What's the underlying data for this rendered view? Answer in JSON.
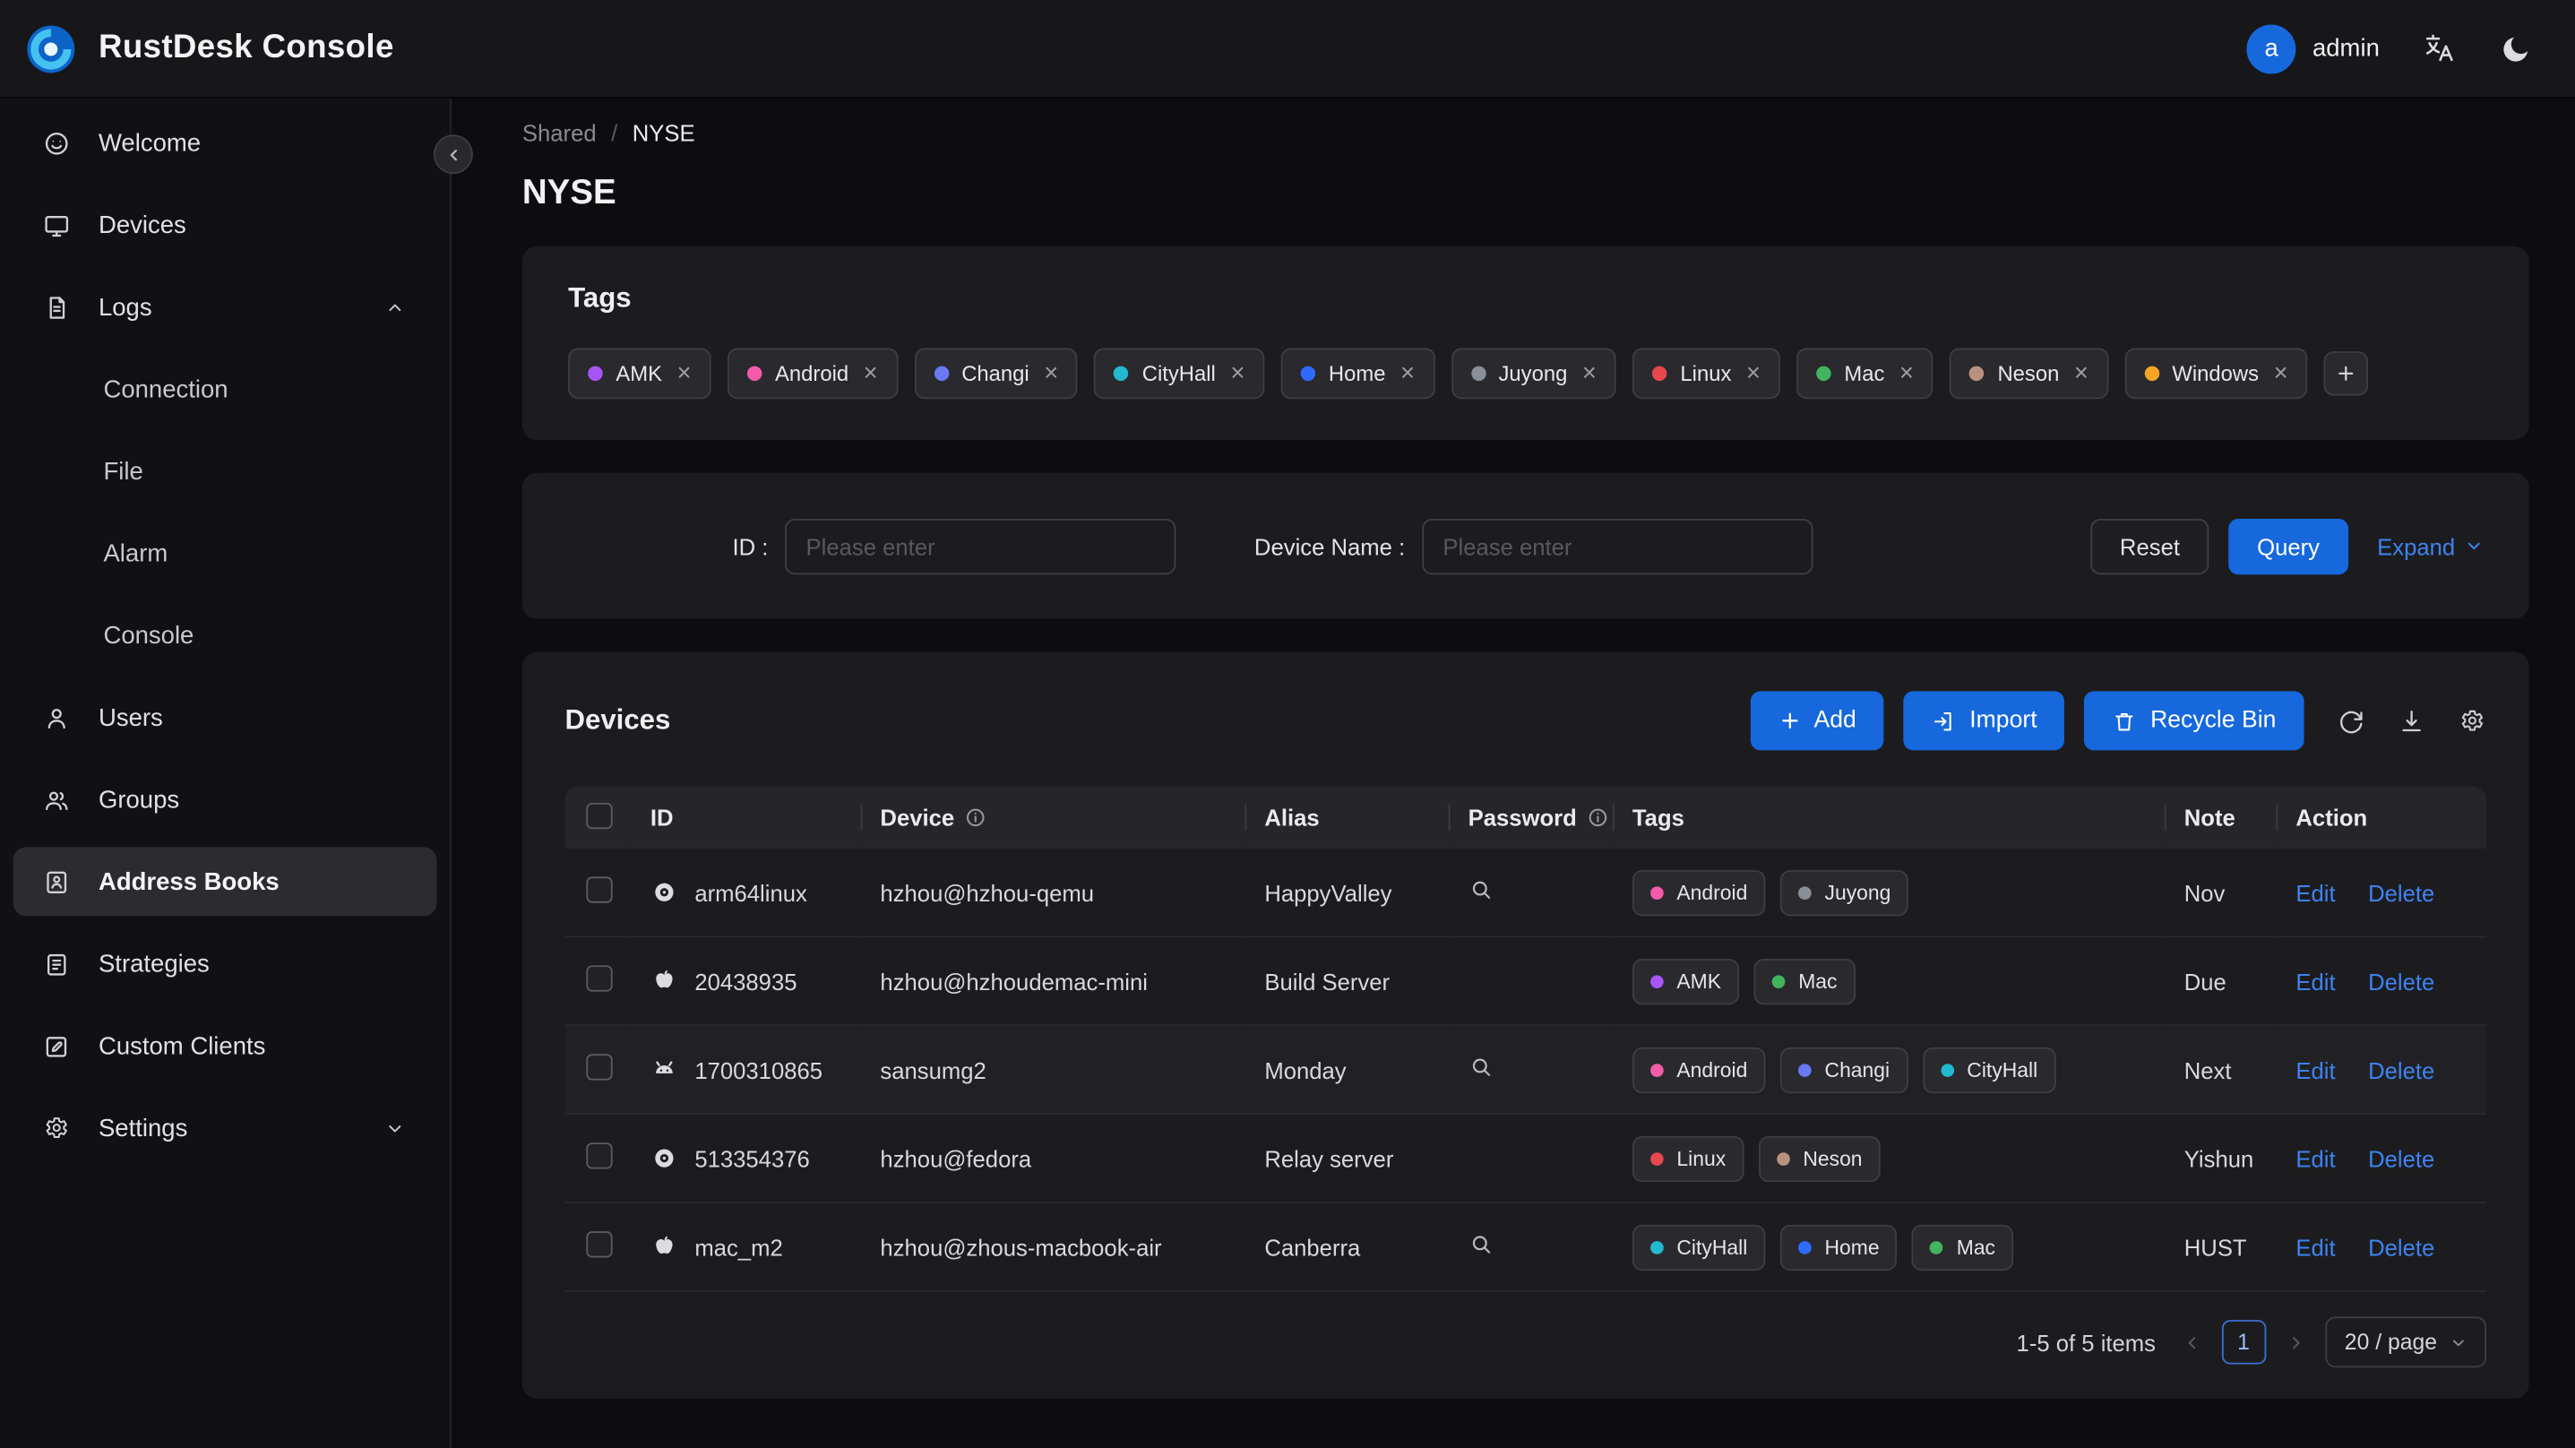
{
  "header": {
    "title": "RustDesk Console",
    "user_initial": "a",
    "user_name": "admin",
    "icons": [
      "rustdesk-logo-icon",
      "translate-icon",
      "moon-icon"
    ]
  },
  "sidebar": {
    "items": [
      {
        "label": "Welcome",
        "icon": "smiley-icon"
      },
      {
        "label": "Devices",
        "icon": "monitor-icon"
      },
      {
        "label": "Logs",
        "icon": "document-icon",
        "expanded": true
      },
      {
        "label": "Connection",
        "child": true
      },
      {
        "label": "File",
        "child": true
      },
      {
        "label": "Alarm",
        "child": true
      },
      {
        "label": "Console",
        "child": true
      },
      {
        "label": "Users",
        "icon": "user-icon"
      },
      {
        "label": "Groups",
        "icon": "users-icon"
      },
      {
        "label": "Address Books",
        "icon": "address-book-icon",
        "selected": true
      },
      {
        "label": "Strategies",
        "icon": "clipboard-icon"
      },
      {
        "label": "Custom Clients",
        "icon": "edit-square-icon"
      },
      {
        "label": "Settings",
        "icon": "gear-icon",
        "collapsed": true
      }
    ]
  },
  "breadcrumb": {
    "parent": "Shared",
    "separator": "/",
    "current": "NYSE"
  },
  "page": {
    "title": "NYSE"
  },
  "tags_card": {
    "title": "Tags",
    "items": [
      {
        "label": "AMK",
        "color": "#a855f7"
      },
      {
        "label": "Android",
        "color": "#f25ca8"
      },
      {
        "label": "Changi",
        "color": "#6a78f2"
      },
      {
        "label": "CityHall",
        "color": "#22b8cf"
      },
      {
        "label": "Home",
        "color": "#2f6bff"
      },
      {
        "label": "Juyong",
        "color": "#8a8f98"
      },
      {
        "label": "Linux",
        "color": "#e5484d"
      },
      {
        "label": "Mac",
        "color": "#44b35f"
      },
      {
        "label": "Neson",
        "color": "#b9927f"
      },
      {
        "label": "Windows",
        "color": "#f5a524"
      }
    ],
    "add_button_icon": "plus-icon"
  },
  "filter": {
    "id_label": "ID :",
    "device_name_label": "Device Name :",
    "placeholder": "Please enter",
    "reset": "Reset",
    "query": "Query",
    "expand": "Expand"
  },
  "devices_card": {
    "title": "Devices",
    "buttons": {
      "add": "Add",
      "import": "Import",
      "recycle_bin": "Recycle Bin"
    },
    "toolbar_icons": [
      "refresh-icon",
      "vertical-align-icon",
      "table-settings-icon"
    ],
    "columns": [
      {
        "label": "ID"
      },
      {
        "label": "Device",
        "info": true
      },
      {
        "label": "Alias"
      },
      {
        "label": "Password",
        "info": true
      },
      {
        "label": "Tags"
      },
      {
        "label": "Note"
      },
      {
        "label": "Action"
      }
    ],
    "actions": {
      "edit": "Edit",
      "delete": "Delete"
    },
    "rows": [
      {
        "os": "linux",
        "id": "arm64linux",
        "device": "hzhou@hzhou-qemu",
        "alias": "HappyValley",
        "password_lookup": true,
        "note": "Nov",
        "tags": [
          {
            "label": "Android",
            "color": "#f25ca8"
          },
          {
            "label": "Juyong",
            "color": "#8a8f98"
          }
        ]
      },
      {
        "os": "apple",
        "id": "20438935",
        "device": "hzhou@hzhoudemac-mini",
        "alias": "Build Server",
        "password_lookup": false,
        "note": "Due",
        "tags": [
          {
            "label": "AMK",
            "color": "#a855f7"
          },
          {
            "label": "Mac",
            "color": "#44b35f"
          }
        ]
      },
      {
        "os": "android",
        "id": "1700310865",
        "device": "sansumg2",
        "alias": "Monday",
        "password_lookup": true,
        "note": "Next",
        "tags": [
          {
            "label": "Android",
            "color": "#f25ca8"
          },
          {
            "label": "Changi",
            "color": "#6a78f2"
          },
          {
            "label": "CityHall",
            "color": "#22b8cf"
          }
        ]
      },
      {
        "os": "linux",
        "id": "513354376",
        "device": "hzhou@fedora",
        "alias": "Relay server",
        "password_lookup": false,
        "note": "Yishun",
        "tags": [
          {
            "label": "Linux",
            "color": "#e5484d"
          },
          {
            "label": "Neson",
            "color": "#b9927f"
          }
        ]
      },
      {
        "os": "apple",
        "id": "mac_m2",
        "device": "hzhou@zhous-macbook-air",
        "alias": "Canberra",
        "password_lookup": true,
        "note": "HUST",
        "tags": [
          {
            "label": "CityHall",
            "color": "#22b8cf"
          },
          {
            "label": "Home",
            "color": "#2f6bff"
          },
          {
            "label": "Mac",
            "color": "#44b35f"
          }
        ]
      }
    ],
    "pagination": {
      "total": "1-5 of 5 items",
      "page": "1",
      "page_size": "20 / page"
    }
  },
  "colors": {
    "accent": "#1668dc",
    "link": "#3e83f0"
  }
}
